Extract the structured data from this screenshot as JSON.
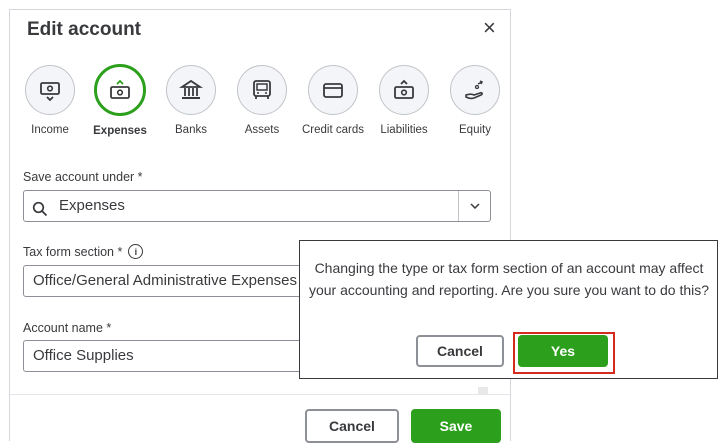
{
  "dialog_title": "Edit account",
  "close_glyph": "×",
  "account_types": [
    {
      "label": "Income",
      "icon": "income-icon",
      "selected": false
    },
    {
      "label": "Expenses",
      "icon": "expenses-icon",
      "selected": true
    },
    {
      "label": "Banks",
      "icon": "bank-icon",
      "selected": false
    },
    {
      "label": "Assets",
      "icon": "assets-icon",
      "selected": false
    },
    {
      "label": "Credit cards",
      "icon": "credit-card-icon",
      "selected": false
    },
    {
      "label": "Liabilities",
      "icon": "liabilities-icon",
      "selected": false
    },
    {
      "label": "Equity",
      "icon": "equity-icon",
      "selected": false
    }
  ],
  "save_under": {
    "label": "Save account under *",
    "value": "Expenses"
  },
  "tax_form": {
    "label": "Tax form section *",
    "info": "i",
    "value": "Office/General Administrative Expenses"
  },
  "account_name": {
    "label": "Account name *",
    "value": "Office Supplies"
  },
  "footer": {
    "cancel": "Cancel",
    "save": "Save"
  },
  "confirm": {
    "message": "Changing the type or tax form section of an account may affect your accounting and reporting. Are you sure you want to do this?",
    "cancel": "Cancel",
    "yes": "Yes"
  },
  "colors": {
    "accent": "#2ca01c",
    "highlight": "#d52b1e",
    "text": "#393a3d"
  }
}
